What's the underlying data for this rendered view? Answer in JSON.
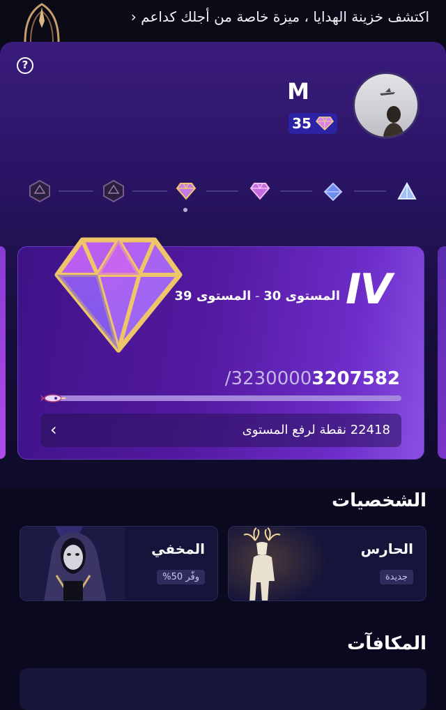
{
  "banner": {
    "text": "اكتشف خزينة الهدايا ، ميزة خاصة من أجلك كداعم",
    "chevron": "‹"
  },
  "profile": {
    "name": "M",
    "points": "35",
    "help_icon": "?"
  },
  "level_track": {
    "icons": [
      "gem-locked",
      "gem-locked",
      "gem-gold",
      "gem-pink",
      "gem-blue",
      "gem-lightblue"
    ]
  },
  "level_card": {
    "tier": "IV",
    "range_from": "المستوى 30",
    "range_sep": " - ",
    "range_to": "المستوى 39",
    "current": "3207582",
    "target": "/3230000",
    "progress_fraction": 0.0,
    "upgrade_text": "22418 نقطة لرفع المستوى",
    "upgrade_chevron": "‹"
  },
  "characters_section": {
    "title": "الشخصيات",
    "items": [
      {
        "name": "الحارس",
        "tag": "جديدة"
      },
      {
        "name": "المخفي",
        "tag": "وفّر 50%"
      }
    ]
  },
  "rewards_section": {
    "title": "المكافآت"
  },
  "colors": {
    "accent": "#2b23a3",
    "gold": "#e8c772",
    "card": "#53199f",
    "background": "#0b0920"
  }
}
